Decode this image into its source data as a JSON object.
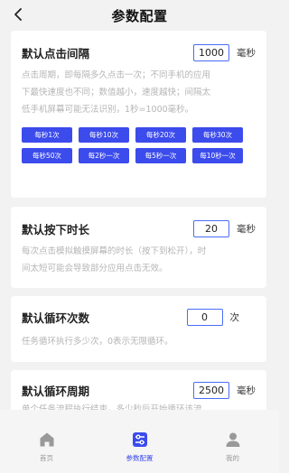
{
  "header": {
    "title": "参数配置"
  },
  "cards": {
    "interval": {
      "title": "默认点击间隔",
      "value": "1000",
      "unit": "毫秒",
      "desc_lines": [
        "点击周期，即每隔多久点击一次；不同手机的应用",
        "下最快速度也不同；数值越小，速度越快；间隔太",
        "低手机屏幕可能无法识别，1秒=1000毫秒。"
      ],
      "buttons": [
        "每秒1次",
        "每秒10次",
        "每秒20次",
        "每秒30次",
        "每秒50次",
        "每2秒一次",
        "每5秒一次",
        "每10秒一次"
      ]
    },
    "press": {
      "title": "默认按下时长",
      "value": "20",
      "unit": "毫秒",
      "desc_lines": [
        "每次点击模拟触摸屏幕的时长（按下到松开），时",
        "间太短可能会导致部分应用点击无效。"
      ]
    },
    "loops": {
      "title": "默认循环次数",
      "value": "0",
      "unit": "次",
      "desc_lines": [
        "任务循环执行多少次，0表示无限循环。"
      ]
    },
    "period": {
      "title": "默认循环周期",
      "value": "2500",
      "unit": "毫秒",
      "desc_lines": [
        "单个任务流程执行结束，多少秒后开始循环该流"
      ]
    }
  },
  "tabs": [
    {
      "label": "首页",
      "icon": "home-icon",
      "active": false
    },
    {
      "label": "参数配置",
      "icon": "settings-sliders-icon",
      "active": true
    },
    {
      "label": "我的",
      "icon": "person-icon",
      "active": false
    }
  ],
  "colors": {
    "accent": "#3b4bec",
    "inactive": "#999999",
    "desc": "#b5b5b5"
  }
}
